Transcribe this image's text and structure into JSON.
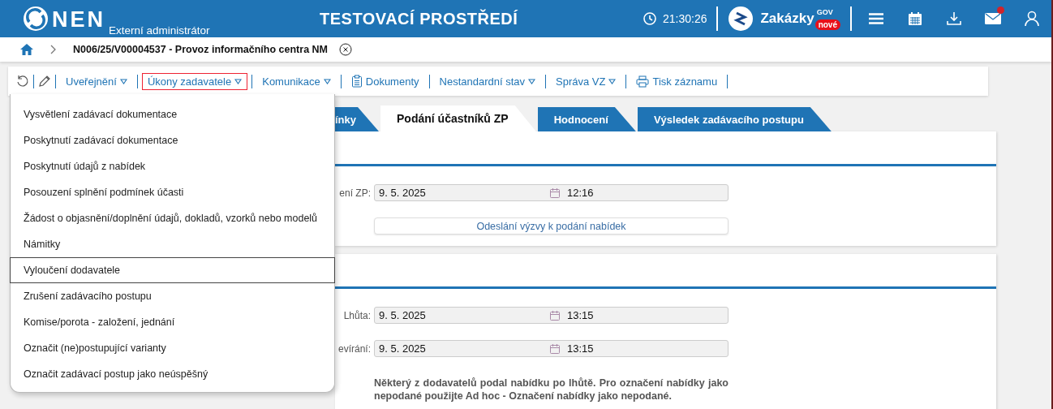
{
  "header": {
    "product": "NEN",
    "role": "Externí administrátor",
    "environment": "TESTOVACÍ PROSTŘEDÍ",
    "time": "21:30:26",
    "brand": "Zakázky",
    "brand_sup": "GOV",
    "brand_badge": "nové",
    "mail_unread": true
  },
  "breadcrumb": {
    "title": "N006/25/V00004537 - Provoz informačního centra NM"
  },
  "toolbar": [
    {
      "kind": "menu",
      "label": "Uveřejnění",
      "open": false
    },
    {
      "kind": "menu",
      "label": "Úkony zadavatele",
      "open": true
    },
    {
      "kind": "menu",
      "label": "Komunikace",
      "open": false
    },
    {
      "kind": "documents",
      "label": "Dokumenty",
      "open": false
    },
    {
      "kind": "menu",
      "label": "Nestandardní stav",
      "open": false
    },
    {
      "kind": "menu",
      "label": "Správa VZ",
      "open": false
    },
    {
      "kind": "print",
      "label": "Tisk záznamu",
      "open": false
    }
  ],
  "dropdown": {
    "items": [
      {
        "label": "Vysvětlení zadávací dokumentace",
        "selected": false
      },
      {
        "label": "Poskytnutí zadávací dokumentace",
        "selected": false
      },
      {
        "label": "Poskytnutí údajů z nabídek",
        "selected": false
      },
      {
        "label": "Posouzení splnění podmínek účasti",
        "selected": false
      },
      {
        "label": "Žádost o objasnění/doplnění údajů, dokladů, vzorků nebo modelů",
        "selected": false
      },
      {
        "label": "Námitky",
        "selected": false
      },
      {
        "label": "Vyloučení dodavatele",
        "selected": true
      },
      {
        "label": "Zrušení zadávacího postupu",
        "selected": false
      },
      {
        "label": "Komise/porota - založení, jednání",
        "selected": false
      },
      {
        "label": "Označit (ne)postupující varianty",
        "selected": false
      },
      {
        "label": "Označit zadávací postup jako neúspěšný",
        "selected": false
      }
    ]
  },
  "tabs": [
    {
      "label": "ínky",
      "selected": false
    },
    {
      "label": "Podání účastníků ZP",
      "selected": true
    },
    {
      "label": "Hodnocení",
      "selected": false
    },
    {
      "label": "Výsledek zadávacího postupu",
      "selected": false
    }
  ],
  "sections": [
    {
      "fields": [
        {
          "label": "ení ZP:",
          "date": "9. 5. 2025",
          "time": "12:16"
        }
      ],
      "action": "Odeslání výzvy k podání nabídek"
    },
    {
      "fields": [
        {
          "label": "Lhůta:",
          "date": "9. 5. 2025",
          "time": "13:15"
        },
        {
          "label": "evírání:",
          "date": "9. 5. 2025",
          "time": "13:15"
        }
      ],
      "note": "Některý z dodavatelů podal nabídku po lhůtě. Pro označení nabídky jako nepodané použijte Ad hoc - Označení nabídky jako nepodané."
    }
  ]
}
